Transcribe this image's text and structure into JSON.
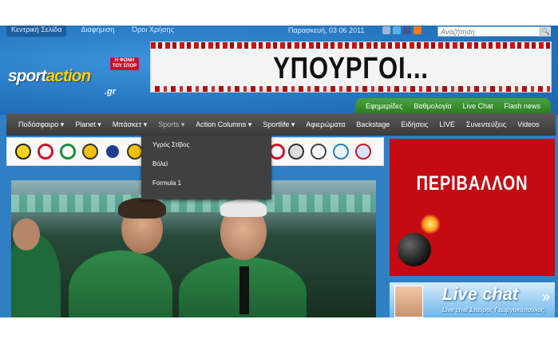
{
  "top_links": [
    "Κεντρική Σελίδα",
    "Διαφήμιση",
    "Όροι Χρήσης"
  ],
  "date": "Παρασκευή, 03 06 2011",
  "search": {
    "placeholder": "Αναζήτηση"
  },
  "logo": {
    "main_a": "sport",
    "main_b": "action",
    "suffix": ".gr",
    "tag": "Η ΦΩΝΗ ΤΟΥ ΣΠΟΡ"
  },
  "banner_text": "ΥΠΟΥΡΓΟΙ...",
  "green_bar": [
    "Εφημερίδες",
    "Βαθμολογία",
    "Live Chat",
    "Flash news"
  ],
  "nav": [
    {
      "label": "Ποδόσφαιρο ▾"
    },
    {
      "label": "Planet ▾"
    },
    {
      "label": "Μπάσκετ ▾"
    },
    {
      "label": "Sports ▾"
    },
    {
      "label": "Action Columns ▾"
    },
    {
      "label": "Sportlife ▾"
    },
    {
      "label": "Αφιερώματα"
    },
    {
      "label": "Backstage"
    },
    {
      "label": "Ειδήσεις"
    },
    {
      "label": "LIVE"
    },
    {
      "label": "Συνεντεύξεις"
    },
    {
      "label": "Videos"
    }
  ],
  "dropdown": [
    "Υγρός Στίβος",
    "Βόλεϊ",
    "Formula 1"
  ],
  "promo_text": "ΠΕΡΙΒΑΛΛΟΝ",
  "live_chat": {
    "title": "Live chat",
    "subtitle": "Live chat Σταύρος Γεωργακόπουλος"
  },
  "colors": {
    "header_blue": "#2576c0",
    "nav_dark": "#3a3a3a",
    "green": "#2d7d24",
    "promo_red": "#c40a12"
  }
}
